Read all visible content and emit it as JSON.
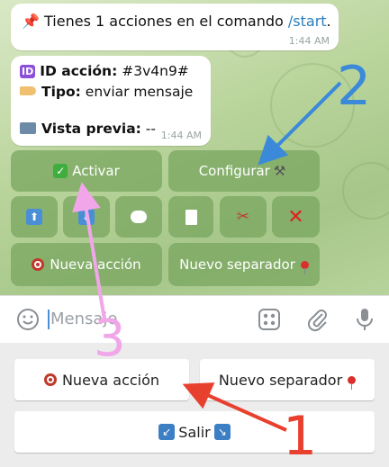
{
  "messages": {
    "pinned": {
      "text": "Tienes 1 acciones en el comando ",
      "link": "/start",
      "suffix": ".",
      "time": "1:44 AM"
    },
    "action": {
      "id_label": "ID acción:",
      "id_value": "#3v4n9#",
      "type_label": "Tipo:",
      "type_value": "enviar mensaje",
      "preview_label": "Vista previa:",
      "preview_value": "--",
      "time": "1:44 AM"
    }
  },
  "inline_keyboard": {
    "activate": "Activar",
    "configure": "Configurar",
    "new_action": "Nueva acción",
    "new_separator": "Nuevo separador",
    "icons": [
      "up-arrow-icon",
      "down-arrow-icon",
      "speech-bubble-icon",
      "document-icon",
      "scissors-icon",
      "red-x-icon"
    ]
  },
  "input": {
    "placeholder": "Mensaje"
  },
  "reply_keyboard": {
    "new_action": "Nueva acción",
    "new_separator": "Nuevo separador",
    "exit": "Salir"
  },
  "annotations": {
    "one": "1",
    "two": "2",
    "three": "3",
    "colors": {
      "one": "#e8402f",
      "two": "#3a8ad9",
      "three": "#f0a6e8"
    }
  }
}
